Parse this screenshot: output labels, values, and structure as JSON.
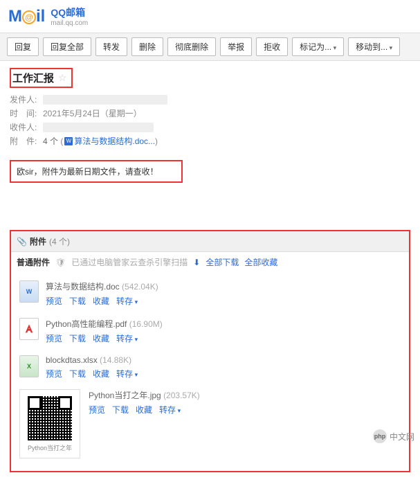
{
  "logo": {
    "qq_text": "QQ邮箱",
    "url": "mail.qq.com"
  },
  "toolbar": {
    "reply": "回复",
    "reply_all": "回复全部",
    "forward": "转发",
    "delete": "删除",
    "delete_forever": "彻底删除",
    "report": "举报",
    "reject": "拒收",
    "mark_as": "标记为...",
    "move_to": "移动到..."
  },
  "mail": {
    "subject": "工作汇报",
    "meta": {
      "from_label": "发件人:",
      "time_label": "时　间:",
      "time_value": "2021年5月24日（星期一）",
      "to_label": "收件人:",
      "attach_label": "附　件:",
      "attach_count": "4 个",
      "attach_first": "算法与数据结构.doc..."
    },
    "body": "欧sir，附件为最新日期文件，请查收！"
  },
  "attachments": {
    "header_title": "附件",
    "header_count": "(4 个)",
    "type_label": "普通附件",
    "scan_msg": "已通过电脑管家云查杀引擎扫描",
    "download_all": "全部下载",
    "favorite_all": "全部收藏",
    "actions": {
      "preview": "预览",
      "download": "下载",
      "favorite": "收藏",
      "save_to": "转存"
    },
    "files": [
      {
        "name": "算法与数据结构.doc",
        "size": "(542.04K)",
        "type": "doc",
        "icon_text": "W"
      },
      {
        "name": "Python高性能编程.pdf",
        "size": "(16.90M)",
        "type": "pdf",
        "icon_text": "PDF"
      },
      {
        "name": "blockdtas.xlsx",
        "size": "(14.88K)",
        "type": "xls",
        "icon_text": "X"
      },
      {
        "name": "Python当打之年.jpg",
        "size": "(203.57K)",
        "type": "img",
        "qr_caption": "Python当打之年"
      }
    ]
  },
  "watermark": {
    "logo": "php",
    "text": "中文网"
  }
}
